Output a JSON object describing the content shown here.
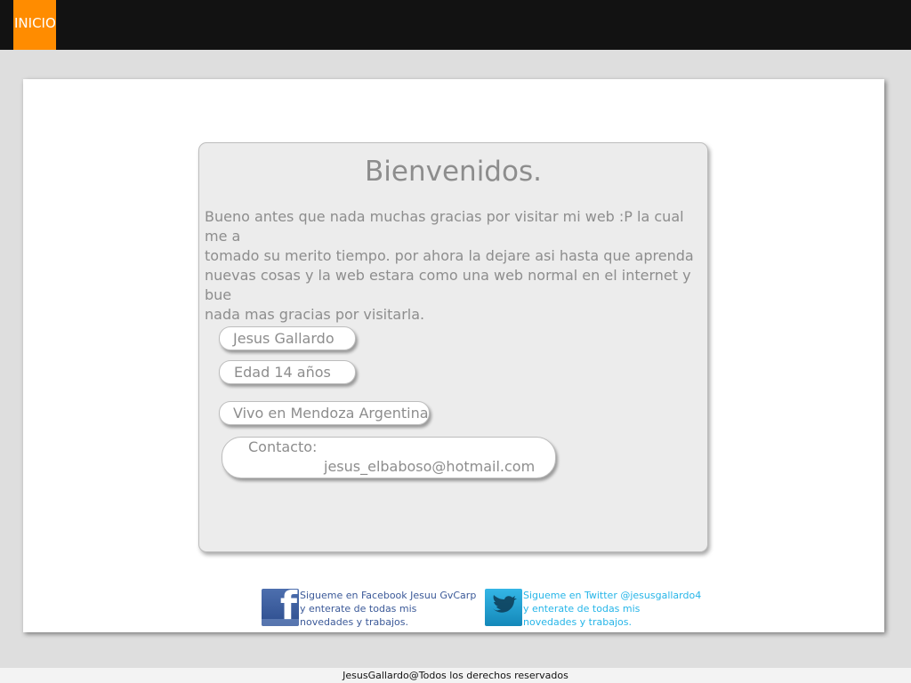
{
  "nav": {
    "inicio_label": "INICIO"
  },
  "welcome": {
    "title": "Bienvenidos.",
    "text": "Bueno antes que nada muchas gracias por visitar mi web :P la cual me a\ntomado su merito tiempo. por ahora la dejare asi hasta que aprenda\nnuevas cosas y la web estara como una web normal en el internet y bue\nnada mas gracias por visitarla."
  },
  "profile": {
    "name": "Jesus Gallardo",
    "age": "Edad 14 años",
    "location": "Vivo en Mendoza Argentina",
    "contact_label": "Contacto:",
    "contact_email": "jesus_elbaboso@hotmail.com"
  },
  "social": {
    "facebook": {
      "icon": "facebook-icon",
      "line1": "Sigueme en Facebook Jesuu GvCarp",
      "line2": " y enterate de todas mis",
      "line3": "novedades y trabajos."
    },
    "twitter": {
      "icon": "twitter-icon",
      "line1": "Sigueme en Twitter @jesusgallardo4",
      "line2": " y enterate de todas mis",
      "line3": "novedades y trabajos."
    }
  },
  "footer": {
    "text": "JesusGallardo@Todos los derechos reservados"
  },
  "colors": {
    "accent": "#ff8c00",
    "topbar": "#121212",
    "text_gray": "#8d8d8d",
    "facebook_blue": "#3b5998",
    "twitter_blue": "#26b5e8"
  }
}
